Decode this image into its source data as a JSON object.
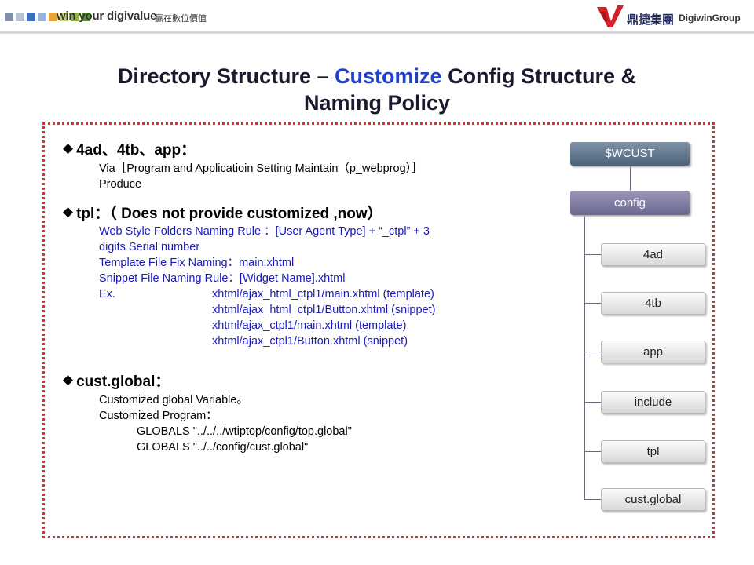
{
  "header": {
    "slogan": "win your digivalue",
    "slogan_sub": "贏在數位價值",
    "brand_cn": "鼎捷集團",
    "brand_en": "DigiwinGroup",
    "square_colors": [
      "#7f8fa6",
      "#b8c2ce",
      "#3d6fb6",
      "#9bb3d8",
      "#e9a53a",
      "#c8d47a",
      "#8fb04a",
      "#5a8f3a"
    ]
  },
  "title": {
    "part1": "Directory Structure – ",
    "accent": "Customize",
    "part2": " Config Structure &",
    "line2": "Naming Policy"
  },
  "sections": {
    "s1": {
      "heading": "4ad、4tb、app：",
      "line1": "Via［Program and Applicatioin Setting Maintain（p_webprog）］",
      "line2": "Produce"
    },
    "s2": {
      "heading": "tpl：（ Does not provide customized ,now）",
      "l1": "Web Style Folders Naming Rule ：[User Agent Type] + “_ctpl” + 3",
      "l2": "digits Serial number",
      "l3": "Template File Fix Naming：main.xhtml",
      "l4": "Snippet File Naming Rule：[Widget Name].xhtml",
      "ex_label": "Ex.",
      "ex1": "xhtml/ajax_html_ctpl1/main.xhtml (template)",
      "ex2": "xhtml/ajax_html_ctpl1/Button.xhtml (snippet)",
      "ex3": "xhtml/ajax_ctpl1/main.xhtml (template)",
      "ex4": "xhtml/ajax_ctpl1/Button.xhtml (snippet)"
    },
    "s3": {
      "heading": "cust.global：",
      "l1": "Customized global Variable。",
      "l2": "Customized Program：",
      "l3": "GLOBALS \"../../../wtiptop/config/top.global\"",
      "l4": "GLOBALS \"../../config/cust.global\""
    }
  },
  "tree": {
    "root": "$WCUST",
    "config": "config",
    "children": [
      "4ad",
      "4tb",
      "app",
      "include",
      "tpl",
      "cust.global"
    ]
  }
}
